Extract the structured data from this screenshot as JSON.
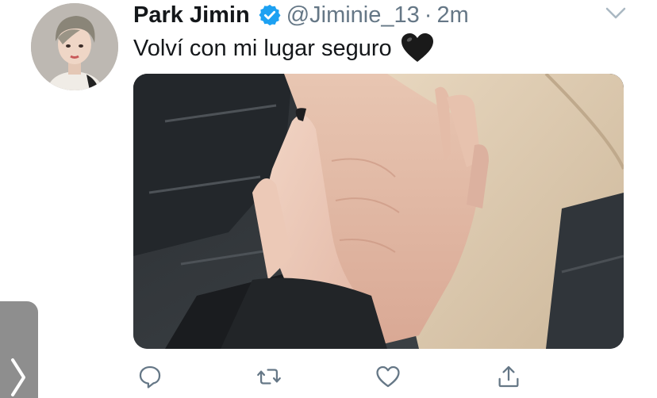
{
  "tweet": {
    "author_name": "Park Jimin",
    "handle": "@Jiminie_13",
    "separator": "·",
    "time": "2m",
    "text": "Volví con mi lugar seguro",
    "emoji": "black-heart",
    "verified": true
  },
  "icons": {
    "verified": "verified-badge-icon",
    "menu": "chevron-down-icon",
    "reply": "comment-icon",
    "retweet": "retweet-icon",
    "like": "heart-icon",
    "share": "share-icon",
    "side_tab": "chevron-right-icon"
  },
  "colors": {
    "accent": "#1da1f2",
    "text_primary": "#14171a",
    "text_secondary": "#657786",
    "side_tab": "#8e8e8e"
  }
}
